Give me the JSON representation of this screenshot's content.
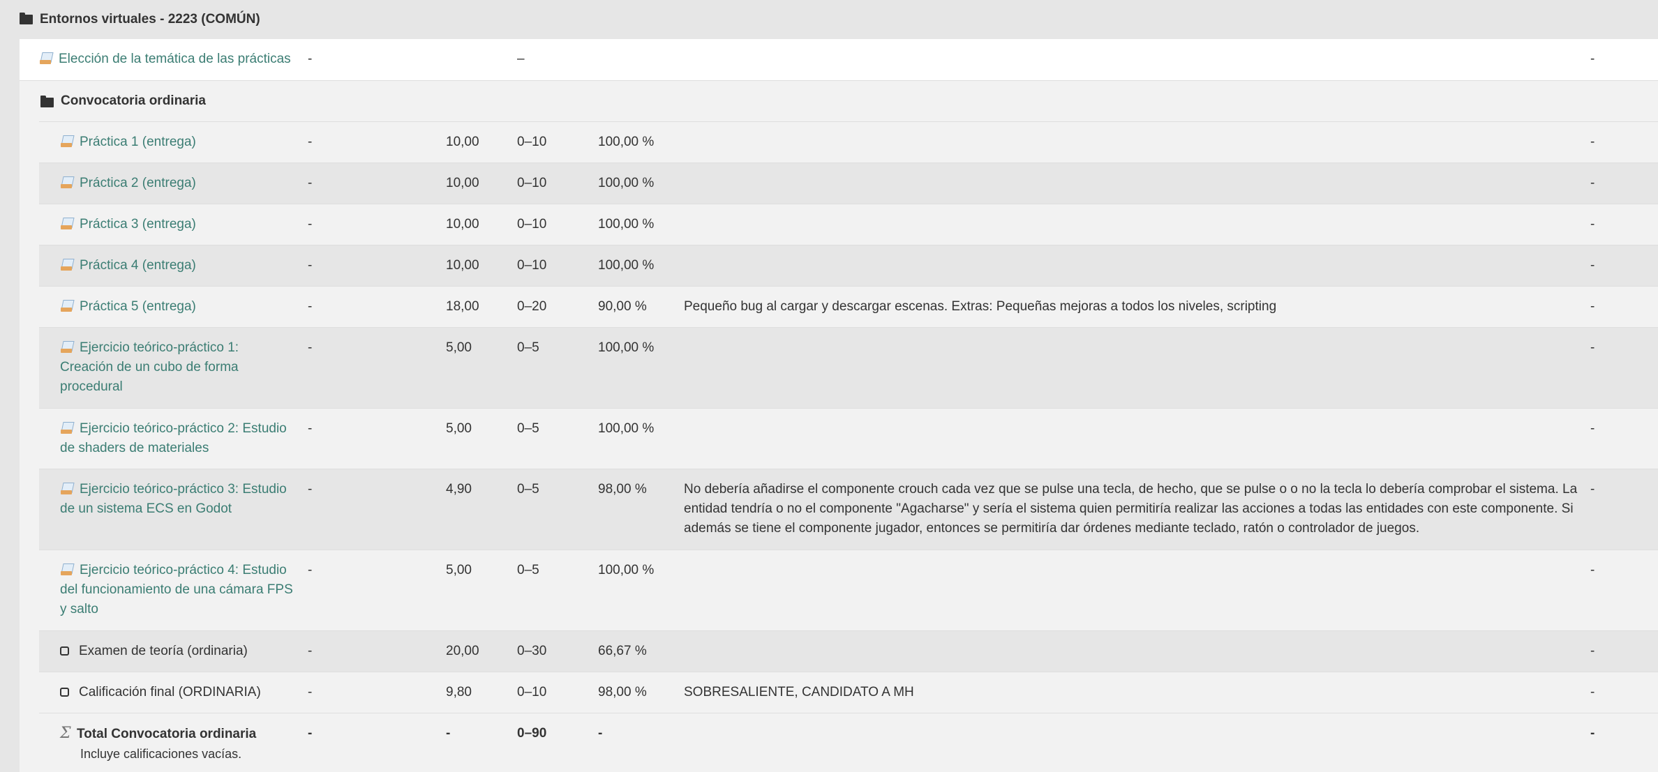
{
  "category": {
    "title": "Entornos virtuales - 2223 (COMÚN)",
    "icon": "folder-icon"
  },
  "top_item": {
    "name": "Elección de la temática de las prácticas",
    "col1": "-",
    "range": "–",
    "last": "-",
    "icon": "assignment-icon"
  },
  "subcategory": {
    "title": "Convocatoria ordinaria",
    "icon": "folder-icon"
  },
  "items": [
    {
      "name": "Práctica 1 (entrega)",
      "col1": "-",
      "grade": "10,00",
      "range": "0–10",
      "pct": "100,00 %",
      "feedback": "",
      "last": "-",
      "icon": "assignment-icon"
    },
    {
      "name": "Práctica 2 (entrega)",
      "col1": "-",
      "grade": "10,00",
      "range": "0–10",
      "pct": "100,00 %",
      "feedback": "",
      "last": "-",
      "icon": "assignment-icon"
    },
    {
      "name": "Práctica 3 (entrega)",
      "col1": "-",
      "grade": "10,00",
      "range": "0–10",
      "pct": "100,00 %",
      "feedback": "",
      "last": "-",
      "icon": "assignment-icon"
    },
    {
      "name": "Práctica 4 (entrega)",
      "col1": "-",
      "grade": "10,00",
      "range": "0–10",
      "pct": "100,00 %",
      "feedback": "",
      "last": "-",
      "icon": "assignment-icon"
    },
    {
      "name": "Práctica 5 (entrega)",
      "col1": "-",
      "grade": "18,00",
      "range": "0–20",
      "pct": "90,00 %",
      "feedback": "Pequeño bug al cargar y descargar escenas. Extras: Pequeñas mejoras a todos los niveles, scripting",
      "last": "-",
      "icon": "assignment-icon"
    },
    {
      "name_lines": [
        "Ejercicio teórico-práctico 1:",
        "Creación de un cubo de forma",
        "procedural"
      ],
      "col1": "-",
      "grade": "5,00",
      "range": "0–5",
      "pct": "100,00 %",
      "feedback": "",
      "last": "-",
      "icon": "assignment-icon"
    },
    {
      "name_lines": [
        "Ejercicio teórico-práctico 2: Estudio",
        "de shaders de materiales"
      ],
      "col1": "-",
      "grade": "5,00",
      "range": "0–5",
      "pct": "100,00 %",
      "feedback": "",
      "last": "-",
      "icon": "assignment-icon"
    },
    {
      "name_lines": [
        "Ejercicio teórico-práctico 3: Estudio",
        "de un sistema ECS en Godot"
      ],
      "col1": "-",
      "grade": "4,90",
      "range": "0–5",
      "pct": "98,00 %",
      "feedback_lines": [
        "No debería añadirse el componente crouch cada vez que se pulse una tecla, de hecho, que se pulse o o no la tecla lo debería comprobar el sistema. La",
        "entidad tendría o no el componente \"Agacharse\" y sería el sistema quien permitiría realizar las acciones a todas las entidades con este componente. Si",
        "además se tiene el componente jugador, entonces se permitiría dar órdenes mediante teclado, ratón o controlador de juegos."
      ],
      "last": "-",
      "icon": "assignment-icon"
    },
    {
      "name_lines": [
        "Ejercicio teórico-práctico 4: Estudio",
        "del funcionamiento de una cámara FPS",
        "y salto"
      ],
      "col1": "-",
      "grade": "5,00",
      "range": "0–5",
      "pct": "100,00 %",
      "feedback": "",
      "last": "-",
      "icon": "assignment-icon"
    },
    {
      "name": "Examen de teoría (ordinaria)",
      "col1": "-",
      "grade": "20,00",
      "range": "0–30",
      "pct": "66,67 %",
      "feedback": "",
      "last": "-",
      "icon": "manual-item-icon"
    },
    {
      "name": "Calificación final (ORDINARIA)",
      "col1": "-",
      "grade": "9,80",
      "range": "0–10",
      "pct": "98,00 %",
      "feedback": "SOBRESALIENTE, CANDIDATO A MH",
      "last": "-",
      "icon": "manual-item-icon"
    }
  ],
  "total": {
    "name": "Total Convocatoria ordinaria",
    "note": "Incluye calificaciones vacías.",
    "col1": "-",
    "grade": "-",
    "range": "0–90",
    "pct": "-",
    "last": "-",
    "icon": "sigma-icon"
  }
}
